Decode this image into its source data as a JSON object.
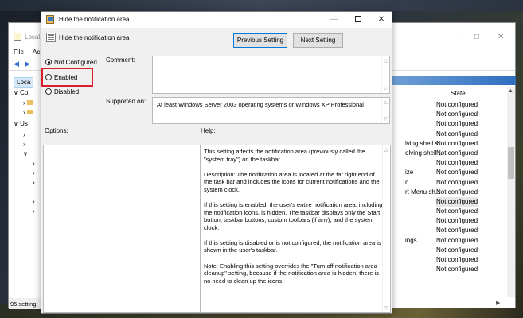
{
  "background_window": {
    "title": "Local",
    "menu": [
      "File",
      "Ac"
    ],
    "tree": {
      "header": "Loca",
      "rows": [
        "Co",
        "",
        "",
        "Us",
        "",
        "",
        "",
        "",
        "",
        "",
        ""
      ]
    },
    "state_header": "State",
    "states": [
      "Not configured",
      "Not configured",
      "Not configured",
      "Not configured",
      "Not configured",
      "Not configured",
      "Not configured",
      "Not configured",
      "Not configured",
      "Not configured",
      "Not configured",
      "Not configured",
      "Not configured",
      "Not configured",
      "Not configured",
      "Not configured",
      "Not configured",
      "Not configured"
    ],
    "name_fragments": [
      "",
      "",
      "",
      "",
      "lving shell s...",
      "olving shell ...",
      "",
      "ize",
      "n",
      "rt Menu sh...",
      "",
      "",
      "",
      "",
      "ings",
      "",
      "",
      ""
    ],
    "status": "95 setting"
  },
  "dialog": {
    "title": "Hide the notification area",
    "header_title": "Hide the notification area",
    "prev_button": "Previous Setting",
    "next_button": "Next Setting",
    "radio_options": [
      {
        "label": "Not Configured",
        "checked": true
      },
      {
        "label": "Enabled",
        "checked": false
      },
      {
        "label": "Disabled",
        "checked": false
      }
    ],
    "comment_label": "Comment:",
    "supported_label": "Supported on:",
    "supported_value": "At least Windows Server 2003 operating systems or Windows XP Professional",
    "options_label": "Options:",
    "help_label": "Help:",
    "help_paragraphs": [
      "This setting affects the notification area (previously called the \"system tray\") on the taskbar.",
      "Description: The notification area is located at the far right end of the task bar and includes the icons for current notifications and the system clock.",
      "If this setting is enabled, the user's entire notification area, including the notification icons, is hidden. The taskbar displays only the Start button, taskbar buttons, custom toolbars (if any), and the system clock.",
      "If this setting is disabled or is not configured, the notification area is shown in the user's taskbar.",
      "Note: Enabling this setting overrides the \"Turn off notification area cleanup\" setting, because if the notification area is hidden, there is no need to clean up the icons."
    ],
    "highlight_color": "#d9202a"
  }
}
